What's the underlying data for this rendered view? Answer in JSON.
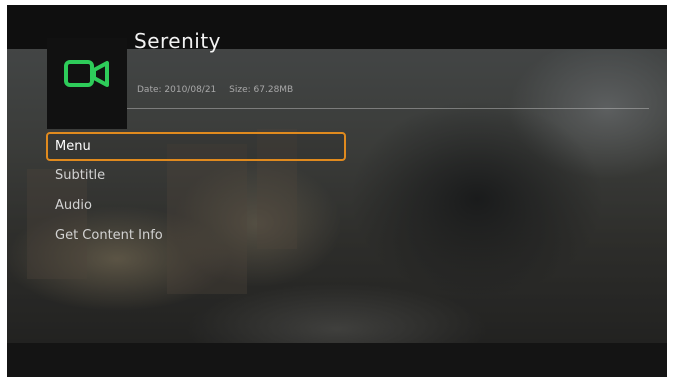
{
  "media": {
    "title": "Serenity",
    "date": "Date: 2010/08/21",
    "size": "Size: 67.28MB",
    "thumbnail_icon": "video-camera-icon",
    "icon_color": "#2ecc5a"
  },
  "menu": {
    "items": [
      {
        "label": "Menu",
        "selected": true
      },
      {
        "label": "Subtitle",
        "selected": false
      },
      {
        "label": "Audio",
        "selected": false
      },
      {
        "label": "Get Content Info",
        "selected": false
      }
    ],
    "highlight_color": "#e08a1e"
  }
}
